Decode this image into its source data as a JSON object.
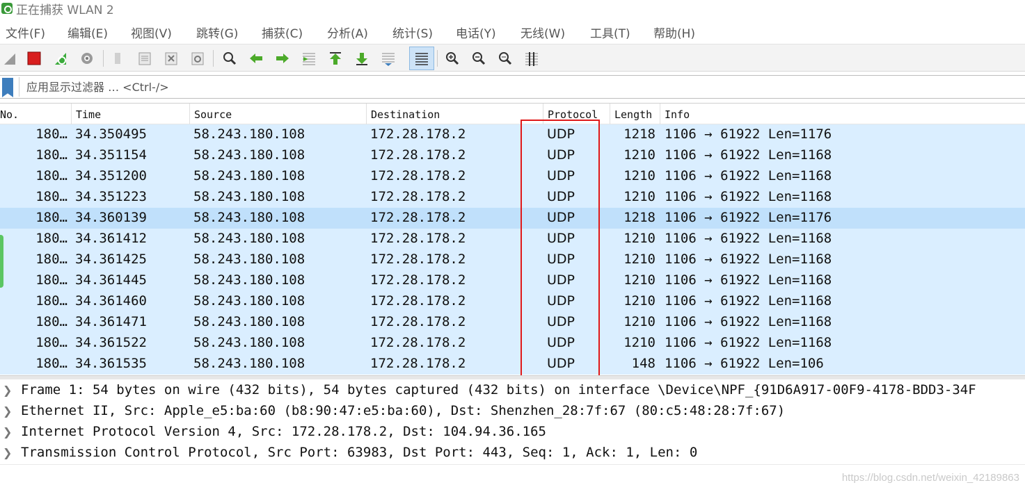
{
  "window": {
    "title": "正在捕获 WLAN 2",
    "icon": "wireshark-fin-icon"
  },
  "menu": [
    {
      "label": "文件(F)"
    },
    {
      "label": "编辑(E)"
    },
    {
      "label": "视图(V)"
    },
    {
      "label": "跳转(G)"
    },
    {
      "label": "捕获(C)"
    },
    {
      "label": "分析(A)"
    },
    {
      "label": "统计(S)"
    },
    {
      "label": "电话(Y)"
    },
    {
      "label": "无线(W)"
    },
    {
      "label": "工具(T)"
    },
    {
      "label": "帮助(H)"
    }
  ],
  "toolbar": {
    "icons": [
      "start-capture-icon",
      "stop-capture-icon",
      "restart-capture-icon",
      "capture-options-icon",
      "open-file-icon",
      "save-file-icon",
      "close-file-icon",
      "reload-file-icon",
      "find-packet-icon",
      "go-back-icon",
      "go-forward-icon",
      "go-to-packet-icon",
      "first-packet-icon",
      "last-packet-icon",
      "autoscroll-icon",
      "colorize-icon",
      "zoom-in-icon",
      "zoom-out-icon",
      "normal-size-icon",
      "resize-columns-icon"
    ]
  },
  "filter": {
    "placeholder": "应用显示过滤器 … <Ctrl-/>",
    "value": ""
  },
  "packet_list": {
    "columns": [
      "No.",
      "Time",
      "Source",
      "Destination",
      "Protocol",
      "Length",
      "Info"
    ],
    "rows": [
      {
        "no": "180…",
        "time": "34.350495",
        "source": "58.243.180.108",
        "destination": "172.28.178.2",
        "protocol": "UDP",
        "length": "1218",
        "info": "1106 → 61922 Len=1176"
      },
      {
        "no": "180…",
        "time": "34.351154",
        "source": "58.243.180.108",
        "destination": "172.28.178.2",
        "protocol": "UDP",
        "length": "1210",
        "info": "1106 → 61922 Len=1168"
      },
      {
        "no": "180…",
        "time": "34.351200",
        "source": "58.243.180.108",
        "destination": "172.28.178.2",
        "protocol": "UDP",
        "length": "1210",
        "info": "1106 → 61922 Len=1168"
      },
      {
        "no": "180…",
        "time": "34.351223",
        "source": "58.243.180.108",
        "destination": "172.28.178.2",
        "protocol": "UDP",
        "length": "1210",
        "info": "1106 → 61922 Len=1168"
      },
      {
        "no": "180…",
        "time": "34.360139",
        "source": "58.243.180.108",
        "destination": "172.28.178.2",
        "protocol": "UDP",
        "length": "1218",
        "info": "1106 → 61922 Len=1176",
        "selected": true
      },
      {
        "no": "180…",
        "time": "34.361412",
        "source": "58.243.180.108",
        "destination": "172.28.178.2",
        "protocol": "UDP",
        "length": "1210",
        "info": "1106 → 61922 Len=1168"
      },
      {
        "no": "180…",
        "time": "34.361425",
        "source": "58.243.180.108",
        "destination": "172.28.178.2",
        "protocol": "UDP",
        "length": "1210",
        "info": "1106 → 61922 Len=1168"
      },
      {
        "no": "180…",
        "time": "34.361445",
        "source": "58.243.180.108",
        "destination": "172.28.178.2",
        "protocol": "UDP",
        "length": "1210",
        "info": "1106 → 61922 Len=1168"
      },
      {
        "no": "180…",
        "time": "34.361460",
        "source": "58.243.180.108",
        "destination": "172.28.178.2",
        "protocol": "UDP",
        "length": "1210",
        "info": "1106 → 61922 Len=1168"
      },
      {
        "no": "180…",
        "time": "34.361471",
        "source": "58.243.180.108",
        "destination": "172.28.178.2",
        "protocol": "UDP",
        "length": "1210",
        "info": "1106 → 61922 Len=1168"
      },
      {
        "no": "180…",
        "time": "34.361522",
        "source": "58.243.180.108",
        "destination": "172.28.178.2",
        "protocol": "UDP",
        "length": "1210",
        "info": "1106 → 61922 Len=1168"
      },
      {
        "no": "180…",
        "time": "34.361535",
        "source": "58.243.180.108",
        "destination": "172.28.178.2",
        "protocol": "UDP",
        "length": "148",
        "info": "1106 → 61922 Len=106"
      }
    ]
  },
  "details": [
    {
      "text": "Frame 1: 54 bytes on wire (432 bits), 54 bytes captured (432 bits) on interface \\Device\\NPF_{91D6A917-00F9-4178-BDD3-34F"
    },
    {
      "text": "Ethernet II, Src: Apple_e5:ba:60 (b8:90:47:e5:ba:60), Dst: Shenzhen_28:7f:67 (80:c5:48:28:7f:67)"
    },
    {
      "text": "Internet Protocol Version 4, Src: 172.28.178.2, Dst: 104.94.36.165"
    },
    {
      "text": "Transmission Control Protocol, Src Port: 63983, Dst Port: 443, Seq: 1, Ack: 1, Len: 0"
    }
  ],
  "watermark": "https://blog.csdn.net/weixin_42189863",
  "colors": {
    "row_udp": "#daeeff",
    "row_selected": "#c0e0fb",
    "annotation_box": "#e01818",
    "filter_bookmark": "#3e7ebd"
  }
}
